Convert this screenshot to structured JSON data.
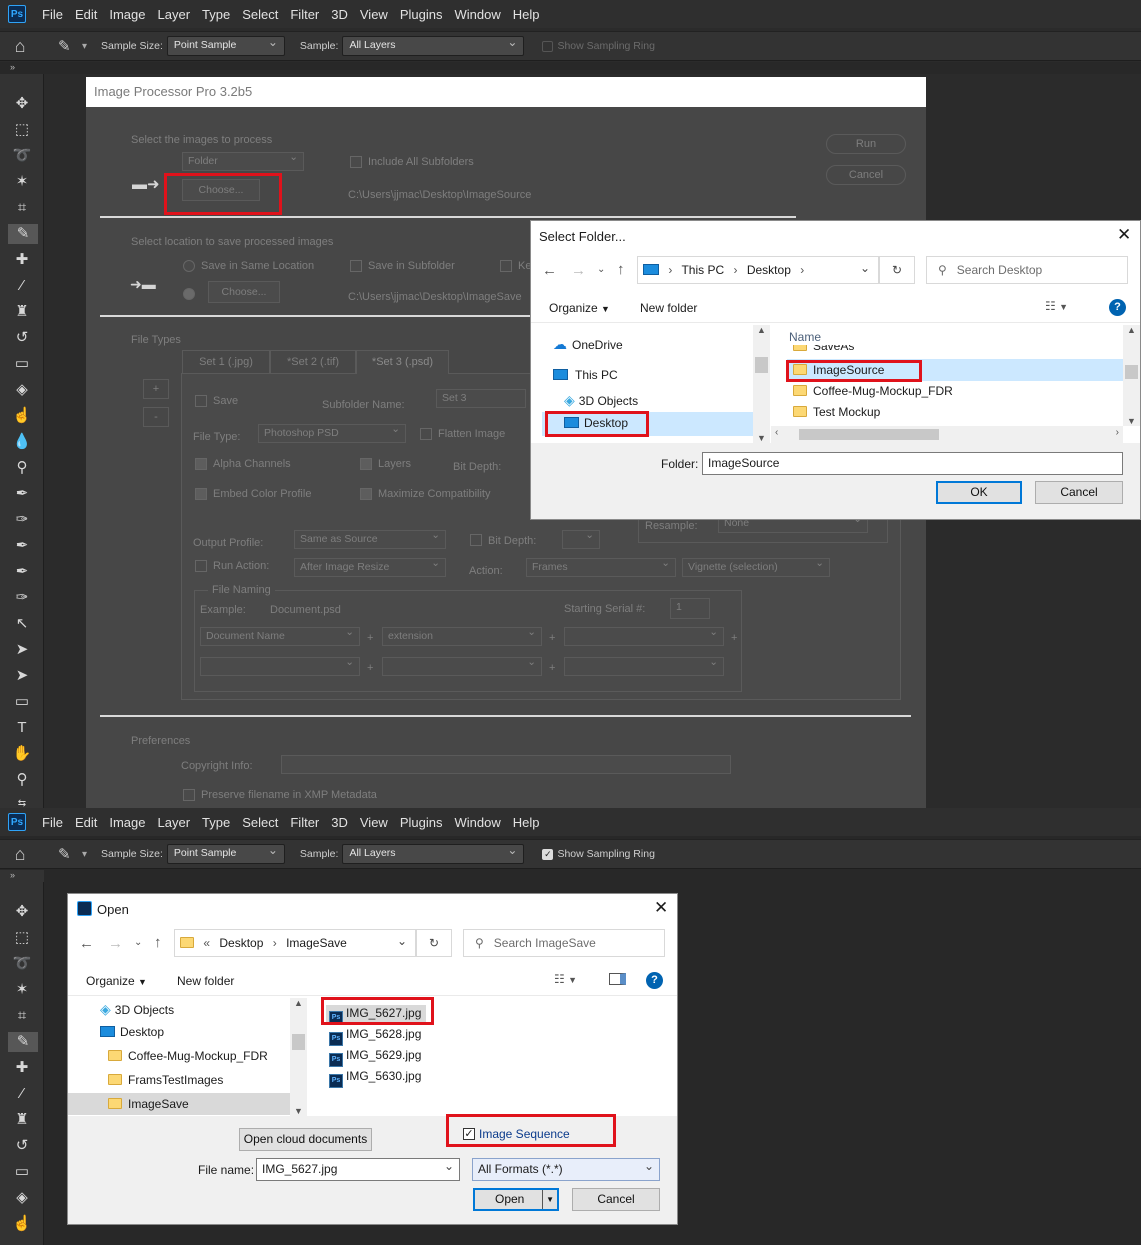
{
  "top": {
    "menu": [
      "File",
      "Edit",
      "Image",
      "Layer",
      "Type",
      "Select",
      "Filter",
      "3D",
      "View",
      "Plugins",
      "Window",
      "Help"
    ],
    "options": {
      "sample_size_label": "Sample Size:",
      "sample_size_value": "Point Sample",
      "sample_label": "Sample:",
      "sample_value": "All Layers",
      "ring_label": "Show Sampling Ring",
      "ring_checked": false
    },
    "processor": {
      "title": "Image Processor Pro 3.2b5",
      "select_images_label": "Select the images to process",
      "source_value": "Folder",
      "include_subfolders": "Include All Subfolders",
      "choose_button": "Choose...",
      "source_path": "C:\\Users\\jjmac\\Desktop\\ImageSource",
      "run_button": "Run",
      "cancel_button": "Cancel",
      "save_location_label": "Select location to save processed images",
      "save_same": "Save in Same Location",
      "save_subfolder": "Save in Subfolder",
      "keep_partial": "Ke",
      "choose_button2": "Choose...",
      "dest_path": "C:\\Users\\jjmac\\Desktop\\ImageSave",
      "file_types_label": "File Types",
      "tabs": [
        "Set 1 (.jpg)",
        "*Set 2 (.tif)",
        "*Set 3 (.psd)"
      ],
      "plus": "+",
      "minus": "-",
      "save_label": "Save",
      "subfolder_name_label": "Subfolder Name:",
      "subfolder_value": "Set 3",
      "file_type_label": "File Type:",
      "file_type_value": "Photoshop PSD",
      "flatten": "Flatten Image",
      "alpha": "Alpha Channels",
      "layers": "Layers",
      "bit_depth_label": "Bit Depth:",
      "embed": "Embed Color Profile",
      "maximize": "Maximize Compatibility",
      "resample_label": "Resample:",
      "resample_value": "None",
      "output_profile_label": "Output Profile:",
      "output_profile_value": "Same as Source",
      "bit_depth2": "Bit Depth:",
      "run_action": "Run Action:",
      "after_resize": "After Image Resize",
      "action_label": "Action:",
      "action_set": "Frames",
      "action_value": "Vignette (selection)",
      "file_naming": "File Naming",
      "example_label": "Example:",
      "example_value": "Document.psd",
      "starting_serial": "Starting Serial #:",
      "serial_value": "1",
      "name_parts": [
        "Document Name",
        "extension"
      ],
      "preferences": "Preferences",
      "copyright": "Copyright Info:",
      "preserve": "Preserve filename in XMP Metadata"
    },
    "select_folder": {
      "title": "Select Folder...",
      "breadcrumb": [
        "This PC",
        "Desktop"
      ],
      "search_placeholder": "Search Desktop",
      "organize": "Organize",
      "new_folder": "New folder",
      "nav": [
        "OneDrive",
        "This PC",
        "3D Objects",
        "Desktop"
      ],
      "column_name": "Name",
      "files": [
        "SaveAs",
        "ImageSource",
        "Coffee-Mug-Mockup_FDR",
        "Test Mockup"
      ],
      "folder_label": "Folder:",
      "folder_value": "ImageSource",
      "ok": "OK",
      "cancel": "Cancel"
    }
  },
  "bottom": {
    "options": {
      "sample_size_label": "Sample Size:",
      "sample_size_value": "Point Sample",
      "sample_label": "Sample:",
      "sample_value": "All Layers",
      "ring_label": "Show Sampling Ring",
      "ring_checked": true
    },
    "open": {
      "title": "Open",
      "breadcrumb_prefix": "«",
      "breadcrumb": [
        "Desktop",
        "ImageSave"
      ],
      "search_placeholder": "Search ImageSave",
      "organize": "Organize",
      "new_folder": "New folder",
      "nav": [
        "3D Objects",
        "Desktop",
        "Coffee-Mug-Mockup_FDR",
        "FramsTestImages",
        "ImageSave"
      ],
      "files": [
        "IMG_5627.jpg",
        "IMG_5628.jpg",
        "IMG_5629.jpg",
        "IMG_5630.jpg"
      ],
      "open_cloud": "Open cloud documents",
      "image_sequence": "Image Sequence",
      "image_sequence_checked": true,
      "file_name_label": "File name:",
      "file_name_value": "IMG_5627.jpg",
      "formats": "All Formats (*.*)",
      "open_button": "Open",
      "cancel_button": "Cancel"
    }
  }
}
